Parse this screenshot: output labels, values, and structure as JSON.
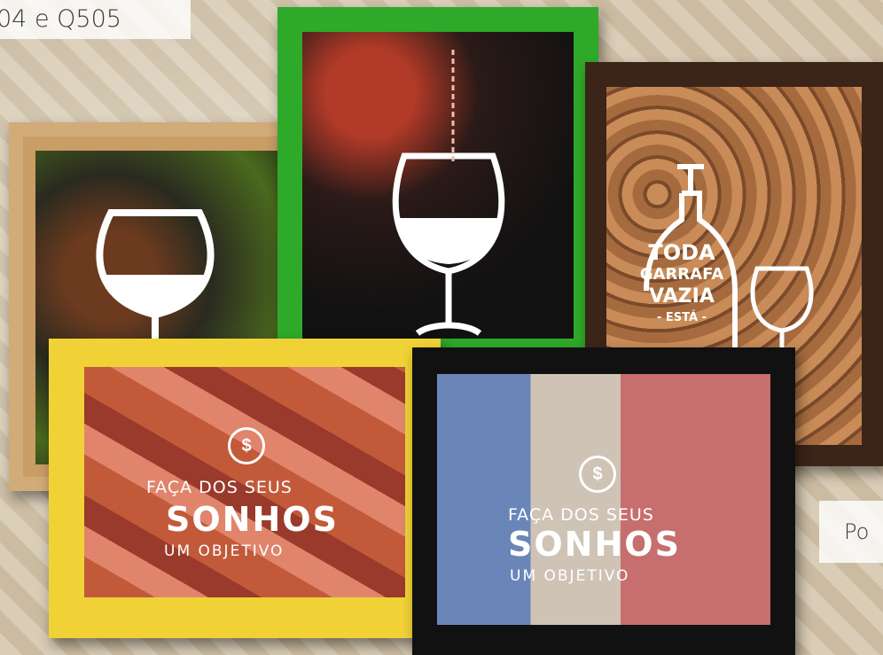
{
  "labels": {
    "top_left": "04 e Q505",
    "right": "Po"
  },
  "frames": {
    "wood": {
      "frame_color": "#d1ab78"
    },
    "green": {
      "frame_color": "#2fa92a"
    },
    "dark": {
      "frame_color": "#3b2418",
      "text_line1": "TODA",
      "text_line2": "GARRAFA",
      "text_line3": "VAZIA",
      "text_line4": "- ESTÁ -"
    },
    "yellow": {
      "frame_color": "#f0d236",
      "dollar": "$",
      "line1": "FAÇA DOS SEUS",
      "line2": "SONHOS",
      "line3": "UM OBJETIVO"
    },
    "black": {
      "frame_color": "#111111",
      "dollar": "$",
      "line1": "FAÇA DOS SEUS",
      "line2": "SONHOS",
      "line3": "UM OBJETIVO"
    }
  }
}
